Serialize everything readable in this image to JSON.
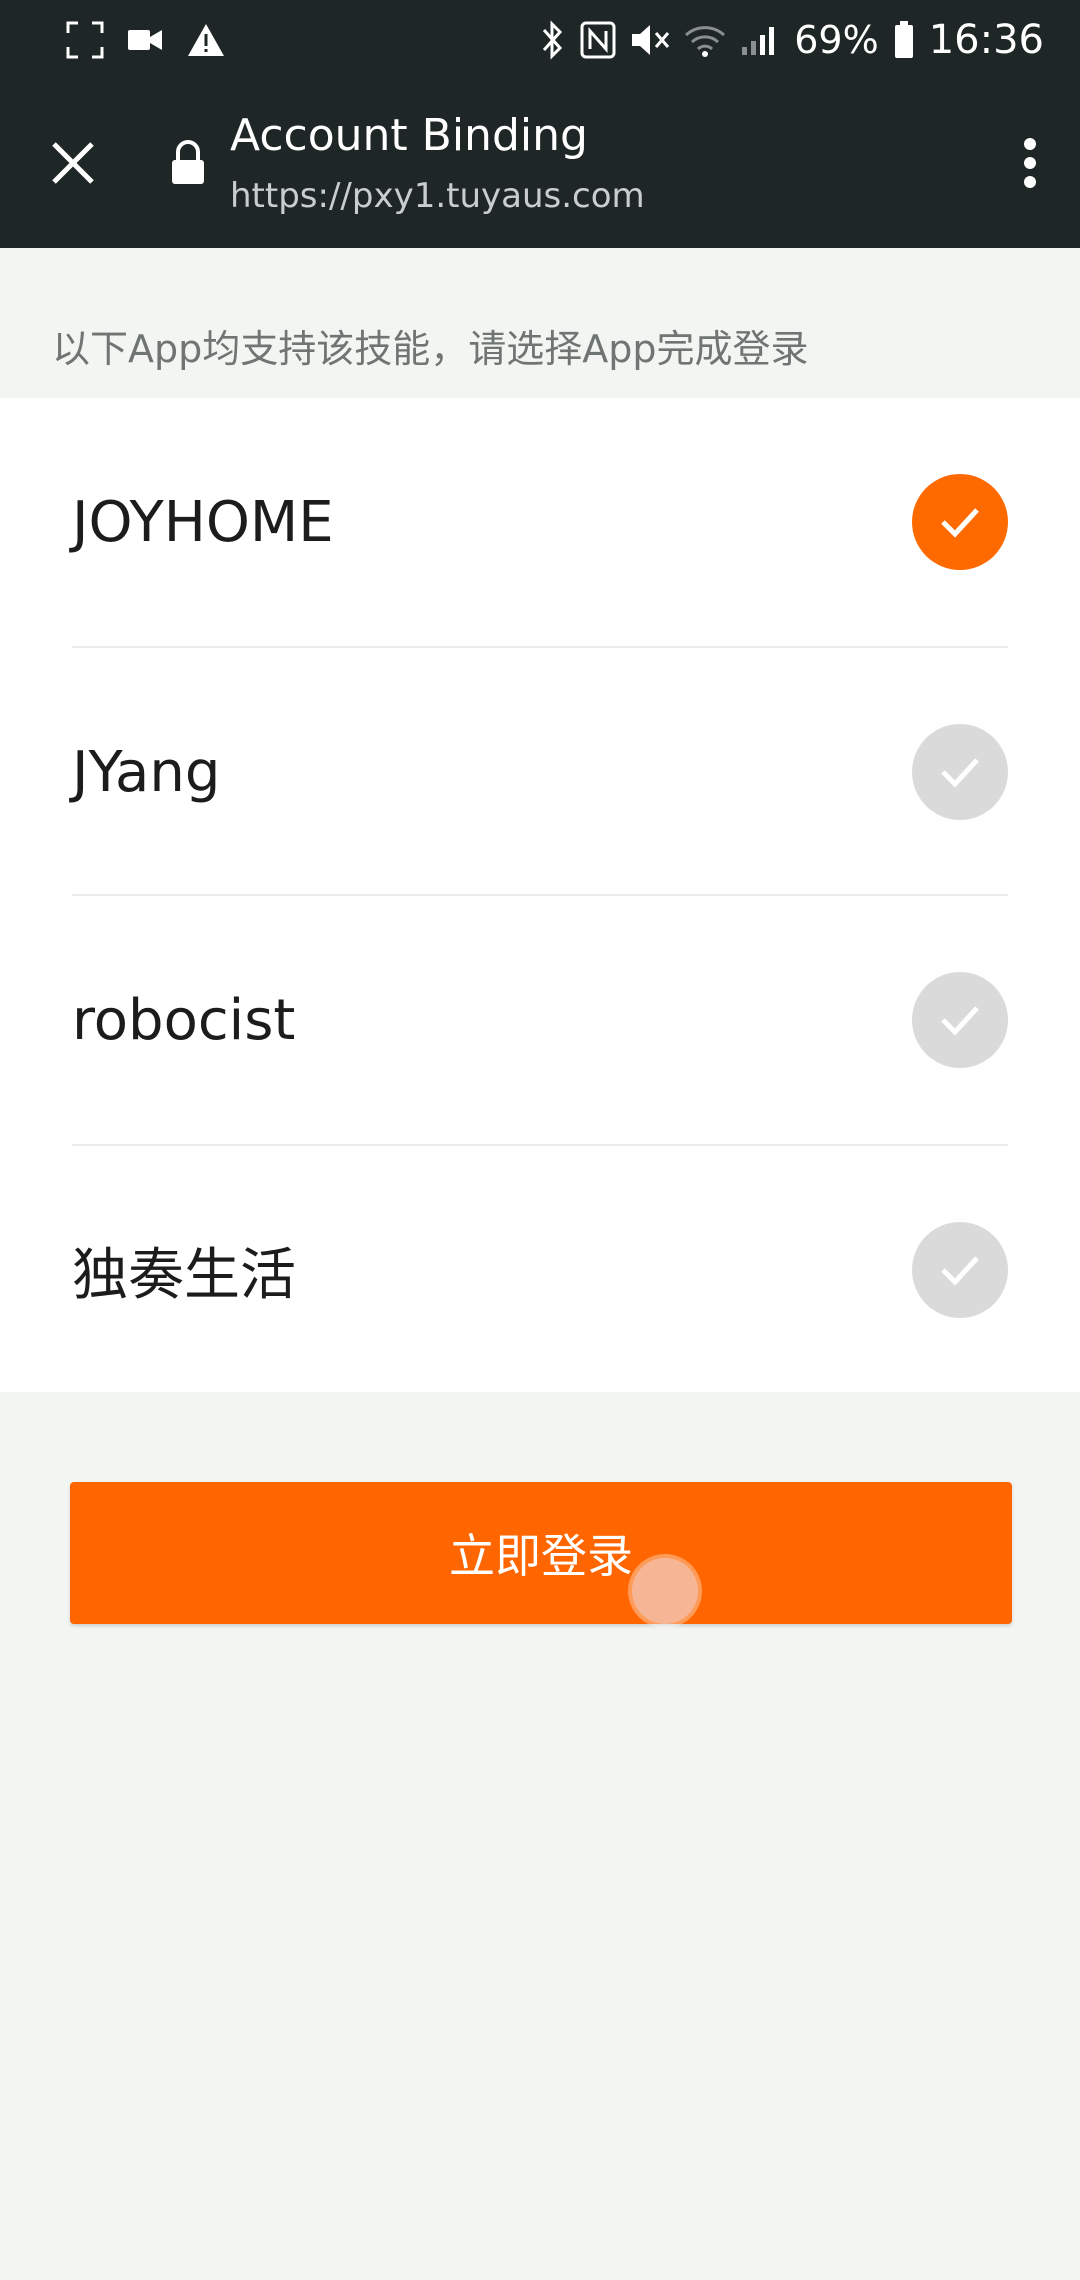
{
  "status_bar": {
    "battery": "69%",
    "time": "16:36",
    "icons": [
      "screenshot-icon",
      "video-icon",
      "warning-icon",
      "bluetooth-icon",
      "nfc-icon",
      "mute-icon",
      "wifi-icon",
      "signal-icon",
      "battery-icon"
    ]
  },
  "toolbar": {
    "title": "Account Binding",
    "url": "https://pxy1.tuyaus.com",
    "icons": [
      "close-icon",
      "lock-icon",
      "more-vert-icon"
    ]
  },
  "hint": "以下App均支持该技能，请选择App完成登录",
  "apps": [
    {
      "label": "JOYHOME",
      "selected": true
    },
    {
      "label": "JYang",
      "selected": false
    },
    {
      "label": "robocist",
      "selected": false
    },
    {
      "label": "独奏生活",
      "selected": false
    }
  ],
  "login_button": "立即登录",
  "colors": {
    "accent": "#ff6600",
    "check_selected": "#ff6a00",
    "check_unselected": "#dadada",
    "toolbar_bg": "#1f2626",
    "page_bg": "#f3f5f2"
  }
}
